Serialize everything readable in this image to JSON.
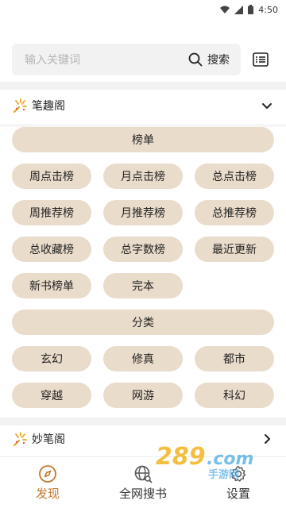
{
  "status_bar": {
    "time": "4:50"
  },
  "search": {
    "placeholder": "输入关键词",
    "button_label": "搜索"
  },
  "section1": {
    "title": "笔趣阁",
    "groups": [
      {
        "header": "榜单",
        "items": [
          "周点击榜",
          "月点击榜",
          "总点击榜",
          "周推荐榜",
          "月推荐榜",
          "总推荐榜",
          "总收藏榜",
          "总字数榜",
          "最近更新",
          "新书榜单",
          "完本"
        ]
      },
      {
        "header": "分类",
        "items": [
          "玄幻",
          "修真",
          "都市",
          "穿越",
          "网游",
          "科幻"
        ]
      }
    ]
  },
  "section2": {
    "title": "妙笔阁"
  },
  "bottom_nav": [
    {
      "label": "发现",
      "icon": "compass-icon",
      "active": true
    },
    {
      "label": "全网搜书",
      "icon": "globe-search-icon",
      "active": false
    },
    {
      "label": "设置",
      "icon": "settings-icon",
      "active": false
    }
  ],
  "watermark": {
    "text": "289.com",
    "subtext": "手游网"
  },
  "colors": {
    "pill_bg": "#eadccb",
    "accent": "#c27a2e",
    "spark": "#f0a020"
  }
}
